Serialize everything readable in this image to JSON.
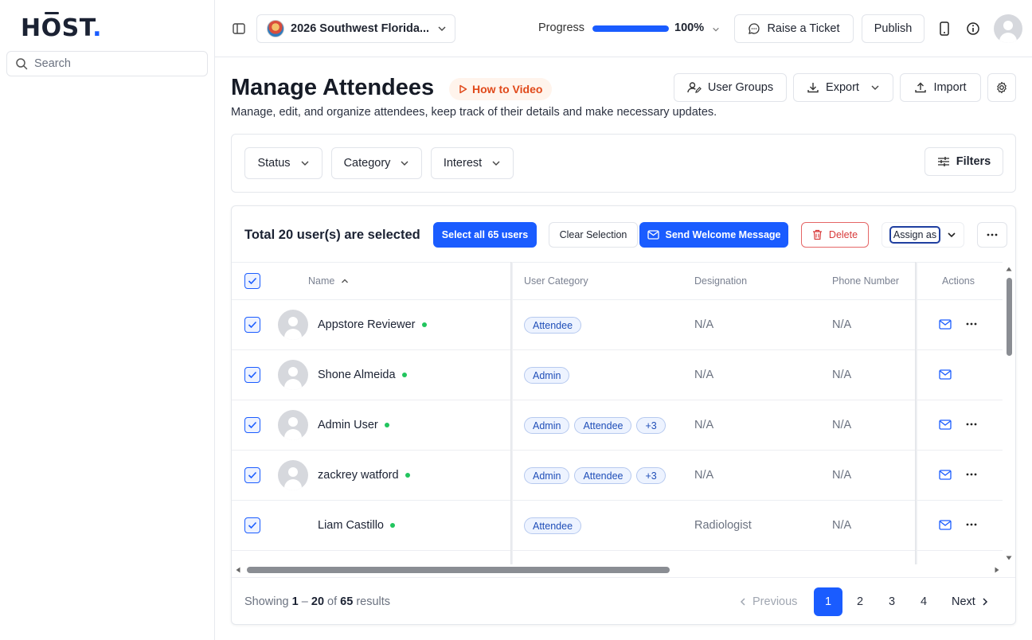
{
  "sidebar": {
    "logo_text": "HOST",
    "logo_dot": ".",
    "search_placeholder": "Search"
  },
  "topbar": {
    "event_name": "2026 Southwest Florida...",
    "progress_label": "Progress",
    "progress_value": "100%",
    "progress_fraction": 1.0,
    "raise_ticket_label": "Raise a Ticket",
    "publish_label": "Publish"
  },
  "header": {
    "title": "Manage Attendees",
    "how_to_video": "How to Video",
    "subtitle": "Manage, edit, and organize attendees, keep track of their details and make necessary updates.",
    "user_groups_label": "User Groups",
    "export_label": "Export",
    "import_label": "Import"
  },
  "filters": {
    "status_label": "Status",
    "category_label": "Category",
    "interest_label": "Interest",
    "filters_label": "Filters"
  },
  "selection_bar": {
    "selected_text": "Total 20 user(s) are selected",
    "select_all_label": "Select all 65 users",
    "clear_selection_label": "Clear Selection",
    "send_welcome_label": "Send Welcome Message",
    "delete_label": "Delete",
    "assign_as_label": "Assign as"
  },
  "table": {
    "columns": {
      "name": "Name",
      "user_category": "User Category",
      "designation": "Designation",
      "phone_number": "Phone Number",
      "actions": "Actions"
    },
    "rows": [
      {
        "name": "Appstore Reviewer",
        "tags": [
          "Attendee"
        ],
        "designation": "N/A",
        "phone": "N/A",
        "has_avatar": true,
        "has_more": true
      },
      {
        "name": "Shone Almeida",
        "tags": [
          "Admin"
        ],
        "designation": "N/A",
        "phone": "N/A",
        "has_avatar": true,
        "has_more": false
      },
      {
        "name": "Admin User",
        "tags": [
          "Admin",
          "Attendee",
          "+3"
        ],
        "designation": "N/A",
        "phone": "N/A",
        "has_avatar": true,
        "has_more": true
      },
      {
        "name": "zackrey watford",
        "tags": [
          "Admin",
          "Attendee",
          "+3"
        ],
        "designation": "N/A",
        "phone": "N/A",
        "has_avatar": true,
        "has_more": true
      },
      {
        "name": "Liam Castillo",
        "tags": [
          "Attendee"
        ],
        "designation": "Radiologist",
        "phone": "N/A",
        "has_avatar": false,
        "has_more": true
      }
    ]
  },
  "pagination": {
    "showing_prefix": "Showing",
    "range_start": "1",
    "range_sep": "–",
    "range_end": "20",
    "of_text": "of",
    "total": "65",
    "results_text": "results",
    "previous_label": "Previous",
    "next_label": "Next",
    "pages": [
      "1",
      "2",
      "3",
      "4"
    ],
    "active_page": "1"
  },
  "colors": {
    "accent": "#1a5cff",
    "danger": "#d83a3a",
    "orange": "#e0491a",
    "online": "#22c55e"
  }
}
